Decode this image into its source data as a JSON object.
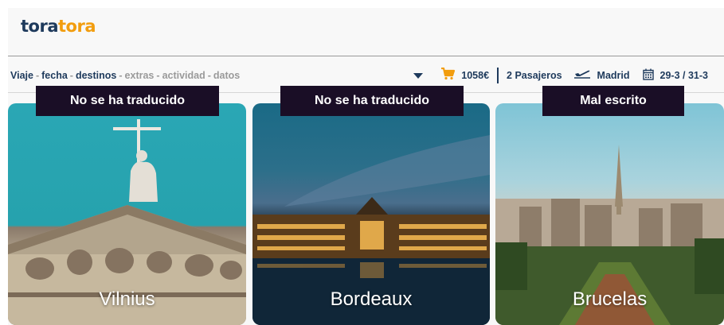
{
  "header": {
    "logo": {
      "part1": "tora",
      "part2": "tora"
    }
  },
  "steps": {
    "items": [
      {
        "label": "Viaje",
        "state": "done"
      },
      {
        "label": "fecha",
        "state": "done"
      },
      {
        "label": "destinos",
        "state": "done"
      },
      {
        "label": "extras",
        "state": "todo"
      },
      {
        "label": "actividad",
        "state": "todo"
      },
      {
        "label": "datos",
        "state": "todo"
      }
    ],
    "separator": "-"
  },
  "summary": {
    "price": "1058€",
    "passengers": "2 Pasajeros",
    "origin": "Madrid",
    "dates": "29-3 / 31-3",
    "icons": {
      "dropdown": "caret-down-icon",
      "cart": "cart-icon",
      "plane": "plane-icon",
      "calendar": "calendar-icon"
    }
  },
  "destinations": [
    {
      "city": "Vilnius",
      "annotation": "No se ha traducido"
    },
    {
      "city": "Bordeaux",
      "annotation": "No se ha traducido"
    },
    {
      "city": "Brucelas",
      "annotation": "Mal escrito"
    }
  ],
  "colors": {
    "brand_navy": "#1e3a5c",
    "brand_orange": "#f29d0e",
    "annotation_bg": "#1a0e26"
  }
}
